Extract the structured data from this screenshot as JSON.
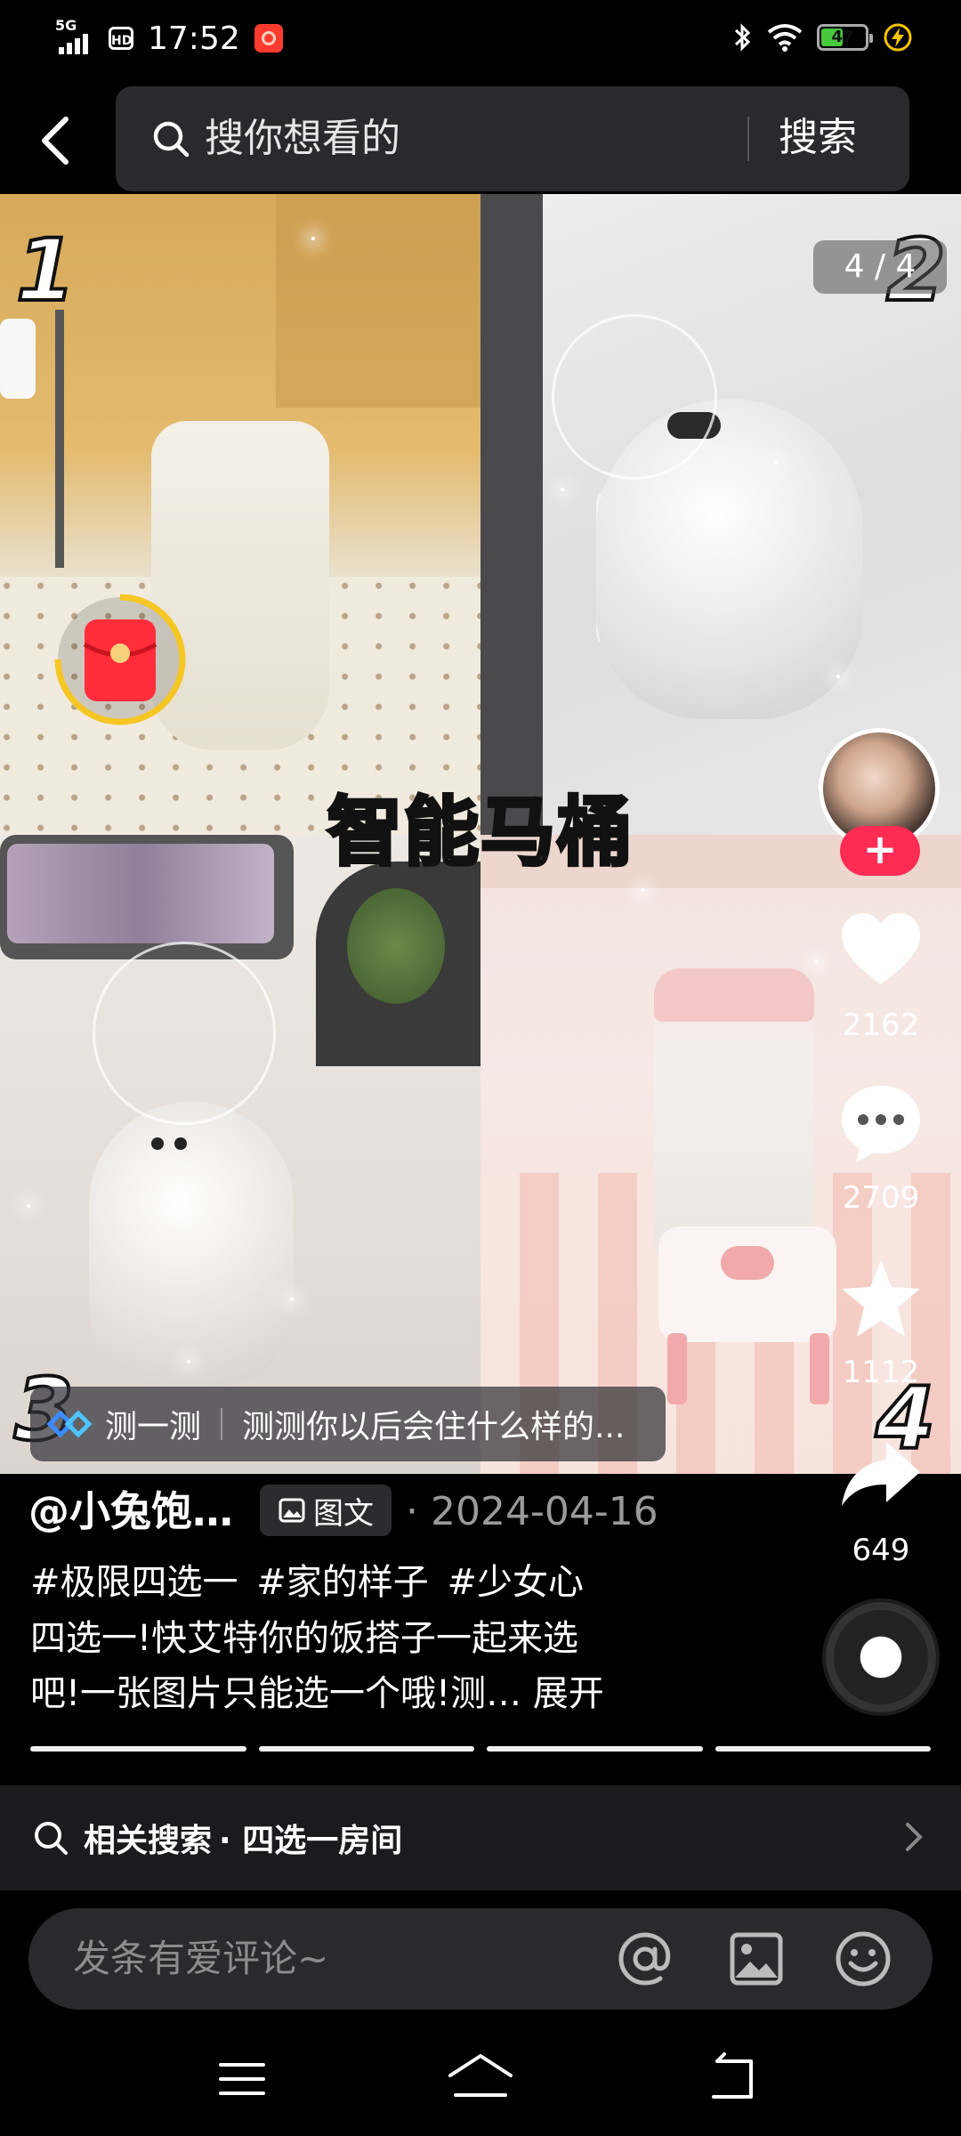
{
  "status_bar": {
    "network": "5G",
    "hd": "HD",
    "time": "17:52",
    "battery": "47"
  },
  "search": {
    "placeholder": "搜你想看的",
    "submit_label": "搜索"
  },
  "post": {
    "overlay_title": "智能马桶",
    "page_indicator": "4 / 4",
    "option_numbers": [
      "1",
      "2",
      "3",
      "4"
    ],
    "quiz": {
      "label": "测一测",
      "text": "测测你以后会住什么样的..."
    },
    "author": "@小兔饱…",
    "type_badge": "图文",
    "date": "· 2024-04-16",
    "hashtags": "#极限四选一 #家的样子 #少女心",
    "description_line1": "四选一!快艾特你的饭搭子一起来选",
    "description_line2": "吧!一张图片只能选一个哦!测…",
    "expand_label": "展开"
  },
  "actions": {
    "follow": "+",
    "likes": "2162",
    "comments": "2709",
    "favorites": "1112",
    "shares": "649"
  },
  "related_search": {
    "label": "相关搜索",
    "term": "· 四选一房间"
  },
  "comment": {
    "placeholder": "发条有爱评论~"
  },
  "colors": {
    "accent_red": "#fe2c55",
    "battery_green": "#48c83c",
    "background": "#000000"
  }
}
